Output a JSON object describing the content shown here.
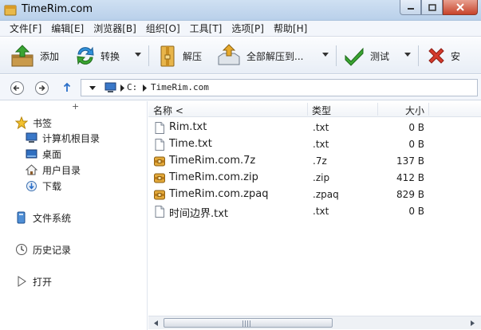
{
  "window": {
    "title": "TimeRim.com"
  },
  "menu": [
    "文件[F]",
    "编辑[E]",
    "浏览器[B]",
    "组织[O]",
    "工具[T]",
    "选项[P]",
    "帮助[H]"
  ],
  "toolbar": {
    "add": "添加",
    "convert": "转换",
    "extract": "解压",
    "extract_all": "全部解压到...",
    "test": "测试",
    "delete": "安"
  },
  "address": {
    "drive": "C:",
    "folder": "TimeRim.com"
  },
  "sidebar": {
    "collapse_glyph": "+",
    "bookmarks": "书签",
    "bookmark_items": [
      "计算机根目录",
      "桌面",
      "用户目录",
      "下载"
    ],
    "filesystem": "文件系统",
    "history": "历史记录",
    "open": "打开"
  },
  "columns": {
    "name": "名称",
    "sort_indicator": "<",
    "type": "类型",
    "size": "大小"
  },
  "files": [
    {
      "name": "Rim.txt",
      "type": ".txt",
      "size": "0 B",
      "icon": "text-file-icon"
    },
    {
      "name": "Time.txt",
      "type": ".txt",
      "size": "0 B",
      "icon": "text-file-icon"
    },
    {
      "name": "TimeRim.com.7z",
      "type": ".7z",
      "size": "137 B",
      "icon": "archive-icon"
    },
    {
      "name": "TimeRim.com.zip",
      "type": ".zip",
      "size": "412 B",
      "icon": "archive-icon"
    },
    {
      "name": "TimeRim.com.zpaq",
      "type": ".zpaq",
      "size": "829 B",
      "icon": "archive-icon"
    },
    {
      "name": "时间边界.txt",
      "type": ".txt",
      "size": "0 B",
      "icon": "text-file-icon"
    }
  ],
  "colors": {
    "title_bar": "#c4d8ee",
    "close_button": "#c7432a",
    "accent_green": "#3aa431"
  }
}
